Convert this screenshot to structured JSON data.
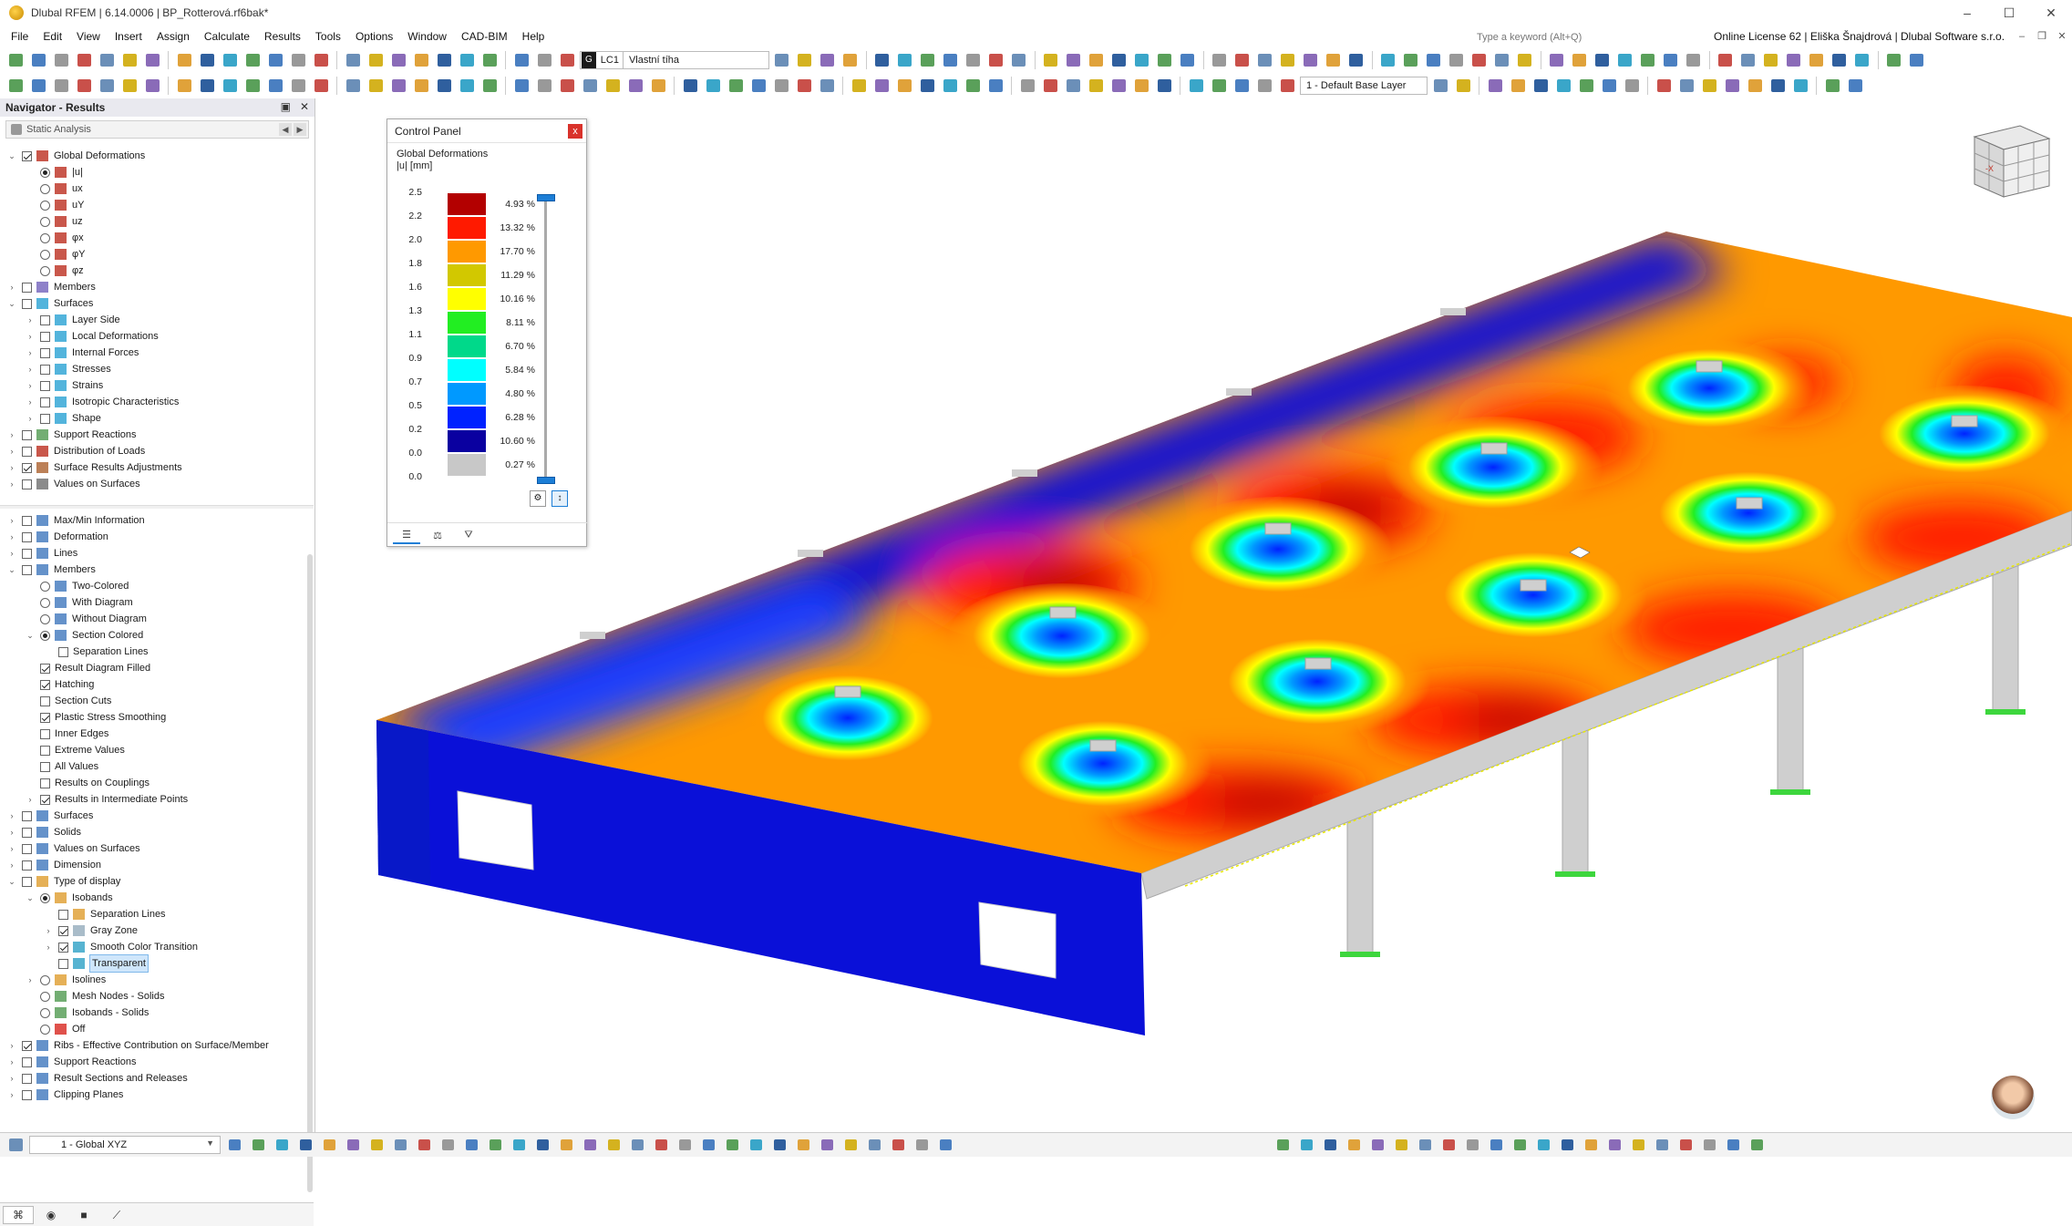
{
  "window": {
    "title": "Dlubal RFEM | 6.14.0006 | BP_Rotterová.rf6bak*",
    "min": "–",
    "max": "☐",
    "close": "✕"
  },
  "menu": [
    "File",
    "Edit",
    "View",
    "Insert",
    "Assign",
    "Calculate",
    "Results",
    "Tools",
    "Options",
    "Window",
    "CAD-BIM",
    "Help"
  ],
  "search": {
    "placeholder": "Type a keyword (Alt+Q)"
  },
  "license": "Online License 62 | Eliška Šnajdrová | Dlubal Software s.r.o.",
  "loadcase": {
    "tag": "G",
    "name": "LC1",
    "description": "Vlastní tíha"
  },
  "layer": "1 - Default Base Layer",
  "navigator": {
    "title": "Navigator - Results",
    "combo": "Static Analysis",
    "tree1": [
      {
        "label": "Global Deformations",
        "lvl": 0,
        "exp": "v",
        "cb": "on",
        "icon": "deform"
      },
      {
        "label": "|u|",
        "lvl": 1,
        "rd": "on",
        "icon": "deform"
      },
      {
        "label": "ux",
        "lvl": 1,
        "rd": "off",
        "icon": "deform"
      },
      {
        "label": "uY",
        "lvl": 1,
        "rd": "off",
        "icon": "deform"
      },
      {
        "label": "uz",
        "lvl": 1,
        "rd": "off",
        "icon": "deform"
      },
      {
        "label": "φx",
        "lvl": 1,
        "rd": "off",
        "icon": "deform"
      },
      {
        "label": "φY",
        "lvl": 1,
        "rd": "off",
        "icon": "deform"
      },
      {
        "label": "φz",
        "lvl": 1,
        "rd": "off",
        "icon": "deform"
      },
      {
        "label": "Members",
        "lvl": 0,
        "exp": ">",
        "cb": "off",
        "icon": "member"
      },
      {
        "label": "Surfaces",
        "lvl": 0,
        "exp": "v",
        "cb": "off",
        "icon": "surface"
      },
      {
        "label": "Layer Side",
        "lvl": 1,
        "exp": ">",
        "cb": "off",
        "icon": "surface"
      },
      {
        "label": "Local Deformations",
        "lvl": 1,
        "exp": ">",
        "cb": "off",
        "icon": "surface"
      },
      {
        "label": "Internal Forces",
        "lvl": 1,
        "exp": ">",
        "cb": "off",
        "icon": "surface"
      },
      {
        "label": "Stresses",
        "lvl": 1,
        "exp": ">",
        "cb": "off",
        "icon": "surface"
      },
      {
        "label": "Strains",
        "lvl": 1,
        "exp": ">",
        "cb": "off",
        "icon": "surface"
      },
      {
        "label": "Isotropic Characteristics",
        "lvl": 1,
        "exp": ">",
        "cb": "off",
        "icon": "surface"
      },
      {
        "label": "Shape",
        "lvl": 1,
        "exp": ">",
        "cb": "off",
        "icon": "surface"
      },
      {
        "label": "Support Reactions",
        "lvl": 0,
        "exp": ">",
        "cb": "off",
        "icon": "support"
      },
      {
        "label": "Distribution of Loads",
        "lvl": 0,
        "exp": ">",
        "cb": "off",
        "icon": "deform"
      },
      {
        "label": "Surface Results Adjustments",
        "lvl": 0,
        "exp": ">",
        "cb": "on",
        "icon": "adjust"
      },
      {
        "label": "Values on Surfaces",
        "lvl": 0,
        "exp": ">",
        "cb": "off",
        "icon": "values"
      }
    ],
    "tree2": [
      {
        "label": "Max/Min Information",
        "lvl": 0,
        "exp": ">",
        "cb": "off",
        "icon": "disp"
      },
      {
        "label": "Deformation",
        "lvl": 0,
        "exp": ">",
        "cb": "off",
        "icon": "disp"
      },
      {
        "label": "Lines",
        "lvl": 0,
        "exp": ">",
        "cb": "off",
        "icon": "disp"
      },
      {
        "label": "Members",
        "lvl": 0,
        "exp": "v",
        "cb": "off",
        "icon": "disp"
      },
      {
        "label": "Two-Colored",
        "lvl": 1,
        "rd": "off",
        "icon": "disp"
      },
      {
        "label": "With Diagram",
        "lvl": 1,
        "rd": "off",
        "icon": "disp"
      },
      {
        "label": "Without Diagram",
        "lvl": 1,
        "rd": "off",
        "icon": "disp"
      },
      {
        "label": "Section Colored",
        "lvl": 1,
        "exp": "v",
        "rd": "on",
        "icon": "disp"
      },
      {
        "label": "Separation Lines",
        "lvl": 2,
        "cb": "off"
      },
      {
        "label": "Result Diagram Filled",
        "lvl": 1,
        "cb": "on"
      },
      {
        "label": "Hatching",
        "lvl": 1,
        "cb": "on"
      },
      {
        "label": "Section Cuts",
        "lvl": 1,
        "cb": "off"
      },
      {
        "label": "Plastic Stress Smoothing",
        "lvl": 1,
        "cb": "on"
      },
      {
        "label": "Inner Edges",
        "lvl": 1,
        "cb": "off"
      },
      {
        "label": "Extreme Values",
        "lvl": 1,
        "cb": "off"
      },
      {
        "label": "All Values",
        "lvl": 1,
        "cb": "off"
      },
      {
        "label": "Results on Couplings",
        "lvl": 1,
        "cb": "off"
      },
      {
        "label": "Results in Intermediate Points",
        "lvl": 1,
        "exp": ">",
        "cb": "on"
      },
      {
        "label": "Surfaces",
        "lvl": 0,
        "exp": ">",
        "cb": "off",
        "icon": "disp"
      },
      {
        "label": "Solids",
        "lvl": 0,
        "exp": ">",
        "cb": "off",
        "icon": "disp"
      },
      {
        "label": "Values on Surfaces",
        "lvl": 0,
        "exp": ">",
        "cb": "off",
        "icon": "disp"
      },
      {
        "label": "Dimension",
        "lvl": 0,
        "exp": ">",
        "cb": "off",
        "icon": "disp"
      },
      {
        "label": "Type of display",
        "lvl": 0,
        "exp": "v",
        "cb": "off",
        "icon": "typedisp"
      },
      {
        "label": "Isobands",
        "lvl": 1,
        "exp": "v",
        "rd": "on",
        "icon": "isoband"
      },
      {
        "label": "Separation Lines",
        "lvl": 2,
        "cb": "off",
        "icon": "isoband"
      },
      {
        "label": "Gray Zone",
        "lvl": 2,
        "exp": ">",
        "cb": "on",
        "icon": "gray"
      },
      {
        "label": "Smooth Color Transition",
        "lvl": 2,
        "exp": ">",
        "cb": "on",
        "icon": "smooth"
      },
      {
        "label": "Transparent",
        "lvl": 2,
        "cb": "off",
        "icon": "smooth",
        "sel": true
      },
      {
        "label": "Isolines",
        "lvl": 1,
        "exp": ">",
        "rd": "off",
        "icon": "isoline"
      },
      {
        "label": "Mesh Nodes - Solids",
        "lvl": 1,
        "rd": "off",
        "icon": "mesh"
      },
      {
        "label": "Isobands - Solids",
        "lvl": 1,
        "rd": "off",
        "icon": "mesh"
      },
      {
        "label": "Off",
        "lvl": 1,
        "rd": "off",
        "icon": "off"
      },
      {
        "label": "Ribs - Effective Contribution on Surface/Member",
        "lvl": 0,
        "exp": ">",
        "cb": "on",
        "icon": "disp"
      },
      {
        "label": "Support Reactions",
        "lvl": 0,
        "exp": ">",
        "cb": "off",
        "icon": "disp"
      },
      {
        "label": "Result Sections and Releases",
        "lvl": 0,
        "exp": ">",
        "cb": "off",
        "icon": "disp"
      },
      {
        "label": "Clipping Planes",
        "lvl": 0,
        "exp": ">",
        "cb": "off",
        "icon": "disp"
      }
    ]
  },
  "control_panel": {
    "title": "Control Panel",
    "close": "x",
    "heading": "Global Deformations",
    "unit": "|u| [mm]",
    "legend": [
      {
        "value": "2.5",
        "color": "#b30000",
        "pct": "4.93 %"
      },
      {
        "value": "2.2",
        "color": "#ff1a00",
        "pct": "13.32 %"
      },
      {
        "value": "2.0",
        "color": "#ff9900",
        "pct": "17.70 %"
      },
      {
        "value": "1.8",
        "color": "#d2c800",
        "pct": "11.29 %"
      },
      {
        "value": "1.6",
        "color": "#ffff00",
        "pct": "10.16 %"
      },
      {
        "value": "1.3",
        "color": "#22ee22",
        "pct": "8.11 %"
      },
      {
        "value": "1.1",
        "color": "#00d98a",
        "pct": "6.70 %"
      },
      {
        "value": "0.9",
        "color": "#00ffff",
        "pct": "5.84 %"
      },
      {
        "value": "0.7",
        "color": "#0099ff",
        "pct": "4.80 %"
      },
      {
        "value": "0.5",
        "color": "#0022ff",
        "pct": "6.28 %"
      },
      {
        "value": "0.2",
        "color": "#0a00a0",
        "pct": "10.60 %"
      },
      {
        "value": "0.0",
        "color": "#c8c8c8",
        "pct": "0.27 %"
      }
    ],
    "legend_bottom": "0.0"
  },
  "statusbar": {
    "coord_system": "1 - Global XYZ"
  },
  "colors": {
    "accent": "#1c7ed6",
    "selection": "#cfe6fb",
    "support": "#3dd63d",
    "concrete": "#cfcfcf"
  }
}
